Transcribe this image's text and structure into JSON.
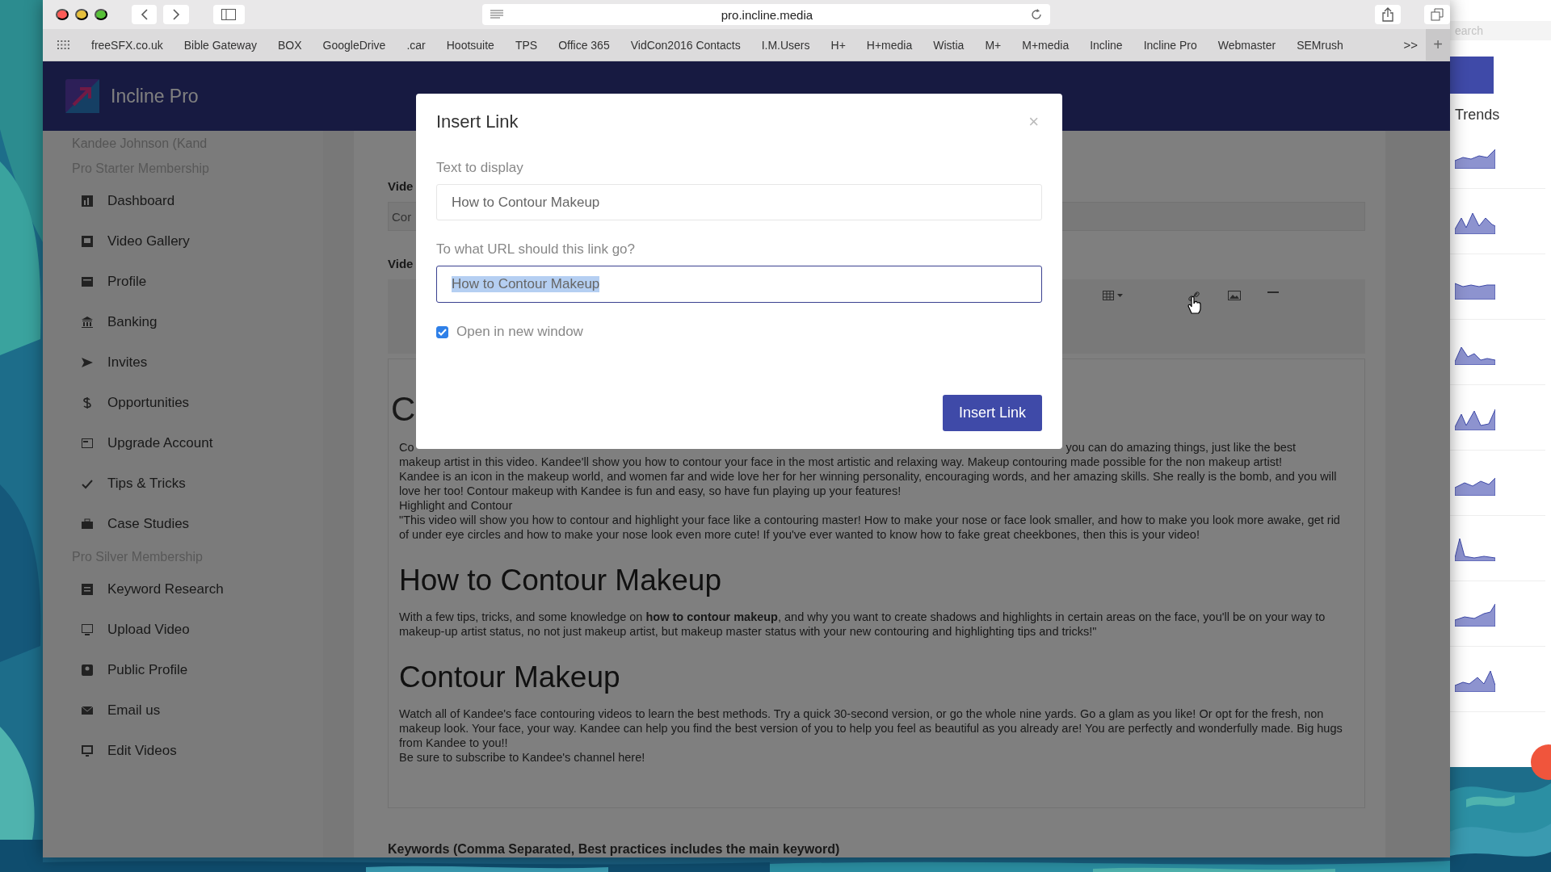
{
  "browser": {
    "url": "pro.incline.media",
    "bookmarks": [
      "freeSFX.co.uk",
      "Bible Gateway",
      "BOX",
      "GoogleDrive",
      ".car",
      "Hootsuite",
      "TPS",
      "Office 365",
      "VidCon2016 Contacts",
      "I.M.Users",
      "H+",
      "H+media",
      "Wistia",
      "M+",
      "M+media",
      "Incline",
      "Incline Pro",
      "Webmaster",
      "SEMrush"
    ],
    "overflow": ">>",
    "new_tab": "+"
  },
  "app": {
    "brand": "Incline Pro",
    "sidebar": [
      {
        "kind": "user",
        "label": "Kandee Johnson (Kand"
      },
      {
        "kind": "section",
        "label": "Pro Starter Membership"
      },
      {
        "kind": "item",
        "label": "Dashboard"
      },
      {
        "kind": "item",
        "label": "Video Gallery"
      },
      {
        "kind": "item",
        "label": "Profile"
      },
      {
        "kind": "item",
        "label": "Banking"
      },
      {
        "kind": "item",
        "label": "Invites"
      },
      {
        "kind": "item",
        "label": "Opportunities"
      },
      {
        "kind": "item",
        "label": "Upgrade Account"
      },
      {
        "kind": "item",
        "label": "Tips & Tricks"
      },
      {
        "kind": "item",
        "label": "Case Studies"
      },
      {
        "kind": "section",
        "label": "Pro Silver Membership"
      },
      {
        "kind": "item",
        "label": "Keyword Research"
      },
      {
        "kind": "item",
        "label": "Upload Video"
      },
      {
        "kind": "item",
        "label": "Public Profile"
      },
      {
        "kind": "item",
        "label": "Email us"
      },
      {
        "kind": "item",
        "label": "Edit Videos"
      }
    ],
    "form": {
      "label_1": "Vide",
      "field_1": "Cor",
      "label_2": "Vide",
      "editor": {
        "heading": "C",
        "intro_left": "Co",
        "intro_right": "you can do amazing things, just like the best",
        "blocks": [
          {
            "kind": "p",
            "text": "makeup artist in this video. Kandee'll show you how to contour your face in the most artistic and relaxing way. Makeup contouring made possible for the non makeup artist!"
          },
          {
            "kind": "p",
            "text": "Kandee is an icon in the makeup world, and women far and wide love her for her winning personality, encouraging words, and her amazing skills. She really is the bomb, and you will love her too! Contour makeup with Kandee is fun and easy, so have fun playing up your features!"
          },
          {
            "kind": "p",
            "text": "Highlight and Contour"
          },
          {
            "kind": "p",
            "text": "\"This video will show you how to contour and highlight your face like a contouring master! How to make your nose or face look smaller, and how to make you look more awake, get rid of under eye circles and how to make your nose look even more cute! If you've ever wanted to know how to fake great cheekbones, then this is your video!"
          },
          {
            "kind": "h2",
            "text": "How to Contour Makeup"
          },
          {
            "kind": "p",
            "text": "With a few tips, tricks, and some knowledge on **how to contour makeup**, and why you want to create shadows and highlights in certain areas on the face, you'll be on your way to makeup-up artist status, no not just makeup artist, but makeup master status with your new contouring and highlighting tips and tricks!\""
          },
          {
            "kind": "h2",
            "text": "Contour Makeup"
          },
          {
            "kind": "p",
            "text": "Watch all of Kandee's face contouring videos to learn the best methods. Try a quick 30-second version, or go the whole nine yards. Go a glam as you like! Or opt for the fresh, non makeup look. Your face, your way. Kandee can help you find the best version of you to help you feel as beautiful as you already are!  You are perfectly and wonderfully made. Big hugs from Kandee to you!!"
          },
          {
            "kind": "p",
            "text": "Be sure to subscribe to Kandee's channel here!"
          }
        ]
      },
      "keywords_label": "Keywords (Comma Separated, Best practices includes the main keyword)"
    }
  },
  "modal": {
    "title": "Insert Link",
    "close": "×",
    "text_label": "Text to display",
    "text_value": "How to Contour Makeup",
    "url_label": "To what URL should this link go?",
    "url_value": "How to Contour Makeup",
    "url_value_selected": true,
    "new_window": {
      "label": "Open in new window",
      "checked": true
    },
    "button": "Insert Link"
  },
  "side_window": {
    "search_placeholder": "earch",
    "trends_title": "Trends",
    "trends": [
      {
        "kind": "sparkline"
      },
      {
        "kind": "sparkline"
      },
      {
        "kind": "sparkline"
      },
      {
        "kind": "sparkline"
      },
      {
        "kind": "sparkline"
      },
      {
        "kind": "sparkline"
      },
      {
        "kind": "sparkline"
      },
      {
        "kind": "sparkline"
      },
      {
        "kind": "sparkline"
      }
    ]
  }
}
